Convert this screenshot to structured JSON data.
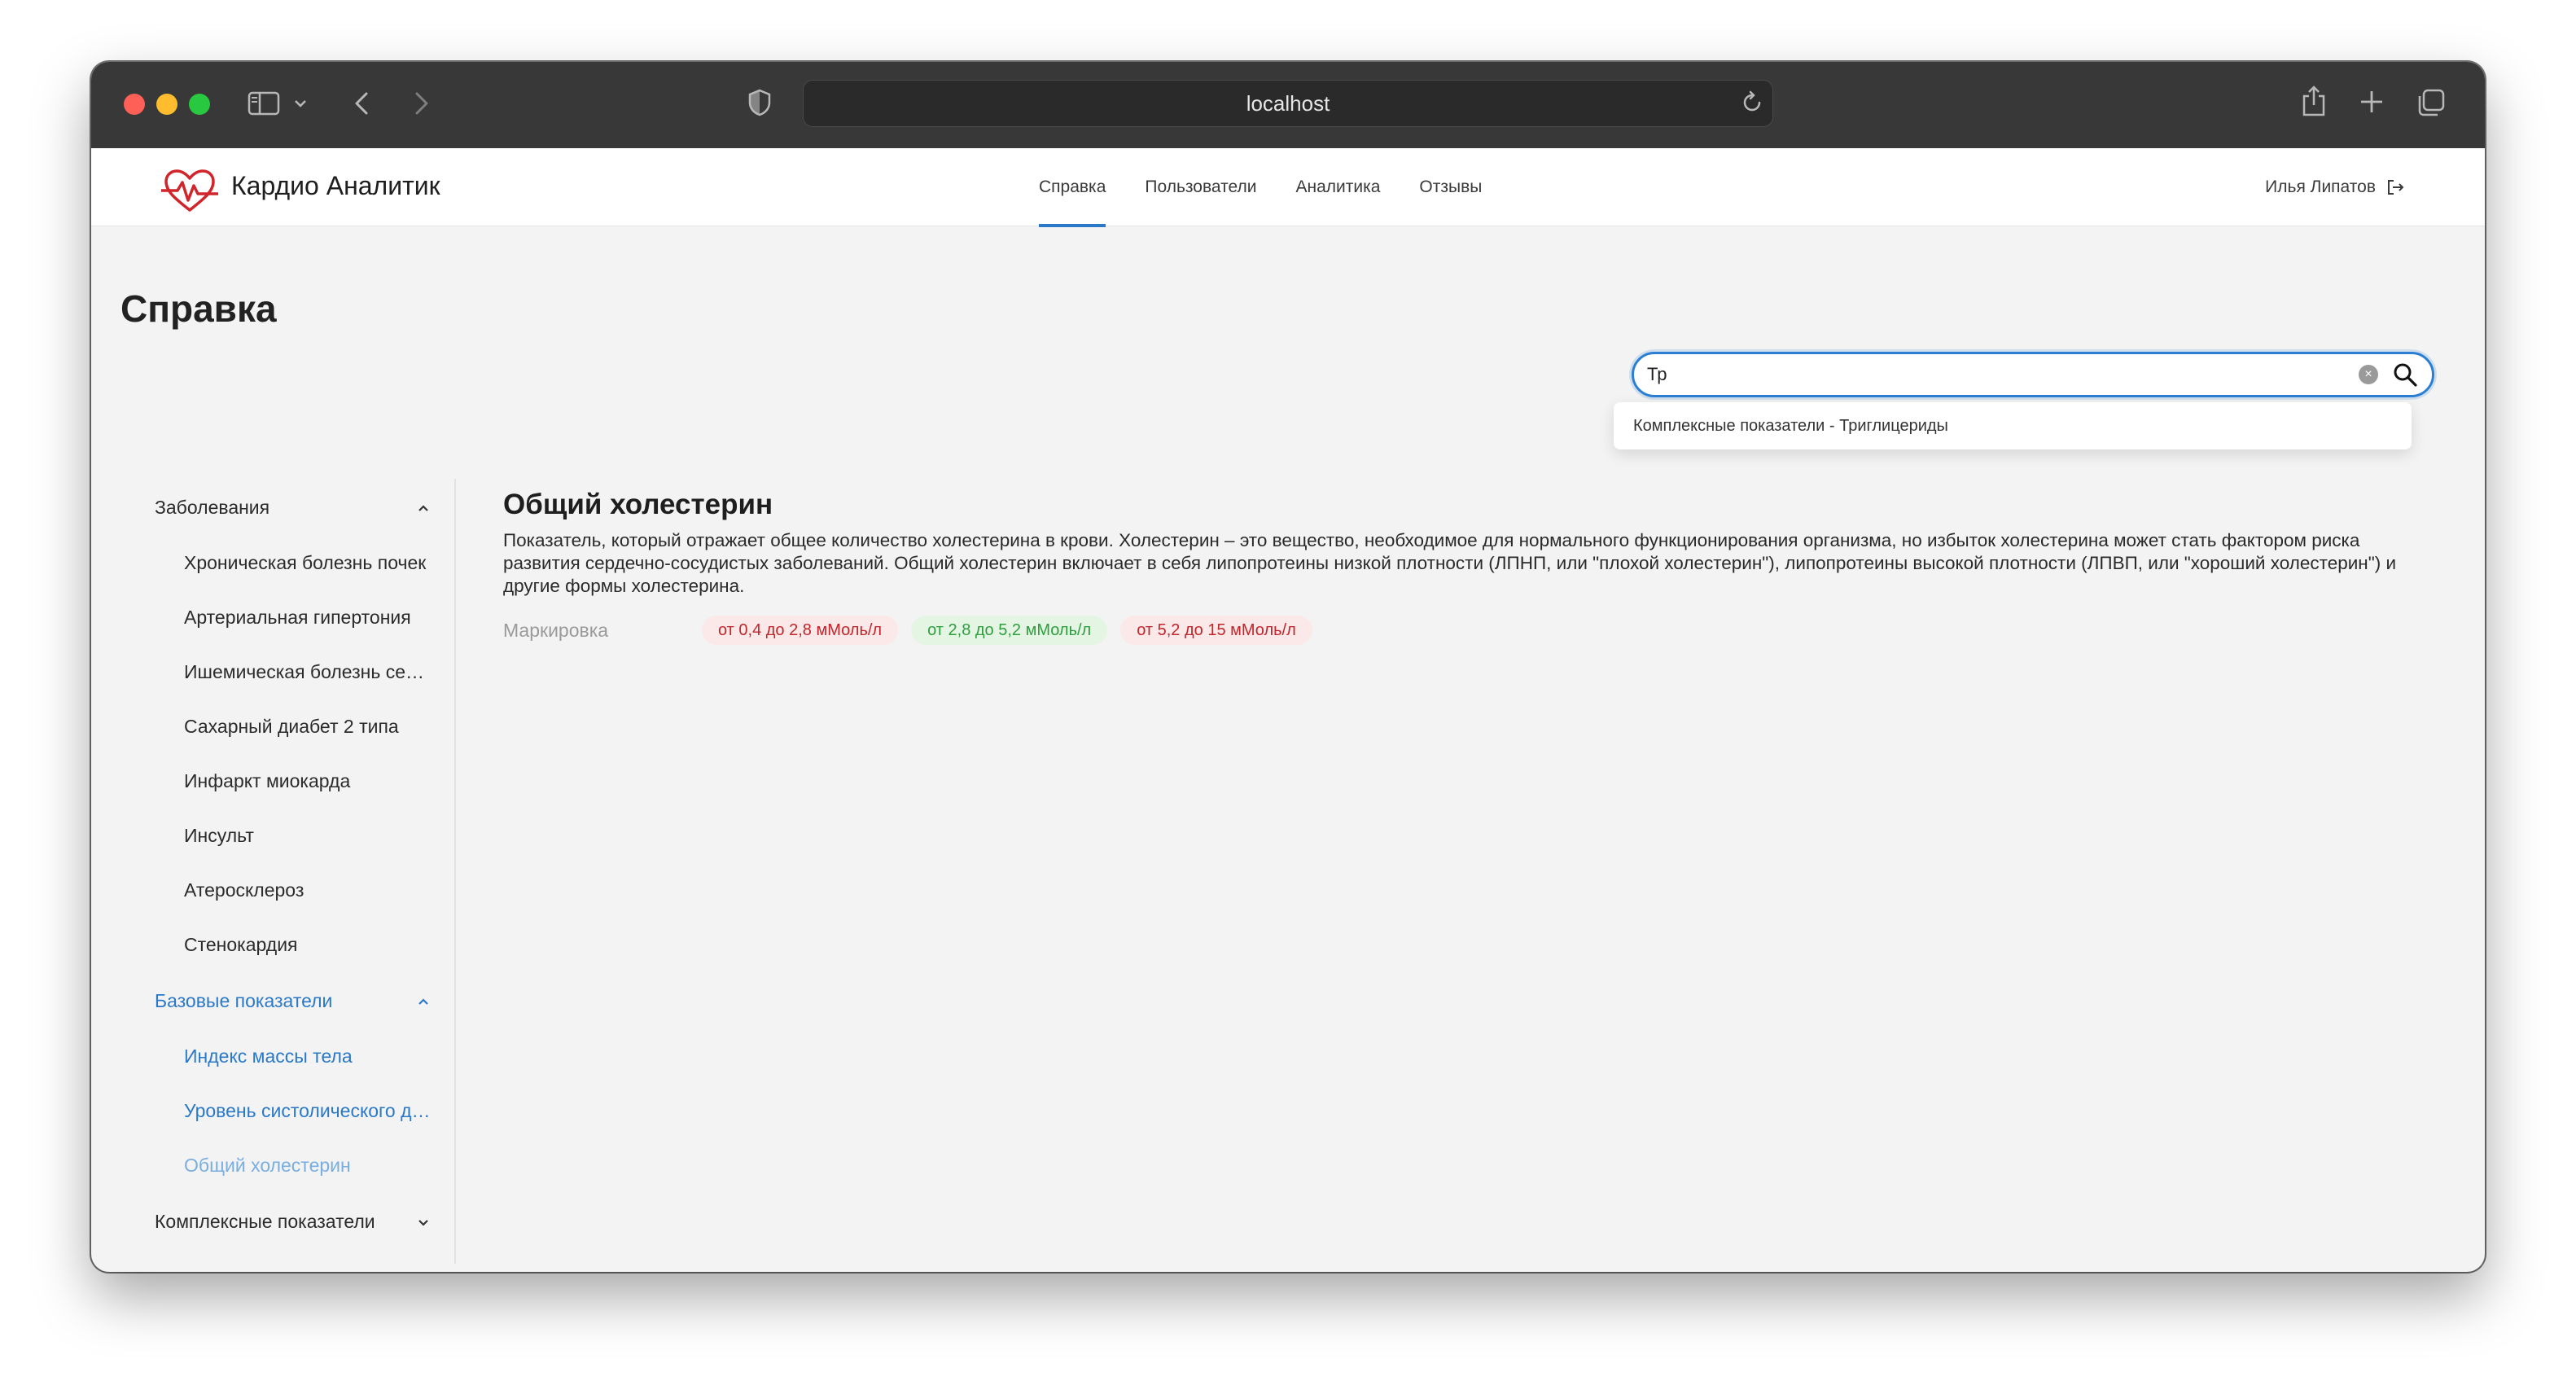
{
  "browser": {
    "url": "localhost"
  },
  "header": {
    "brand": "Кардио Аналитик",
    "nav": [
      {
        "label": "Справка",
        "active": true
      },
      {
        "label": "Пользователи",
        "active": false
      },
      {
        "label": "Аналитика",
        "active": false
      },
      {
        "label": "Отзывы",
        "active": false
      }
    ],
    "user_name": "Илья Липатов"
  },
  "page": {
    "title": "Справка"
  },
  "search": {
    "value": "Тр",
    "suggestion": "Комплексные показатели - Триглицериды"
  },
  "sidebar": {
    "groups": [
      {
        "label": "Заболевания",
        "expanded": true,
        "items": [
          "Хроническая болезнь почек",
          "Артериальная гипертония",
          "Ишемическая болезнь сердца",
          "Сахарный диабет 2 типа",
          "Инфаркт миокарда",
          "Инсульт",
          "Атеросклероз",
          "Стенокардия"
        ]
      },
      {
        "label": "Базовые показатели",
        "expanded": true,
        "items": [
          "Индекс массы тела",
          "Уровень систолического давления",
          "Общий холестерин"
        ]
      },
      {
        "label": "Комплексные показатели",
        "expanded": false,
        "items": []
      }
    ]
  },
  "article": {
    "title": "Общий холестерин",
    "description": "Показатель, который отражает общее количество холестерина в крови. Холестерин – это вещество, необходимое для нормального функционирования организма, но избыток холестерина может стать фактором риска развития сердечно-сосудистых заболеваний. Общий холестерин включает в себя липопротеины низкой плотности (ЛПНП, или \"плохой холестерин\"), липопротеины высокой плотности (ЛПВП, или \"хороший холестерин\") и другие формы холестерина.",
    "marks_label": "Маркировка",
    "marks": [
      {
        "text": "от 0,4 до 2,8 мМоль/л",
        "status": "red"
      },
      {
        "text": "от 2,8 до 5,2 мМоль/л",
        "status": "green"
      },
      {
        "text": "от 5,2 до 15 мМоль/л",
        "status": "red"
      }
    ]
  },
  "colors": {
    "accent": "#2a79c9",
    "danger": "#c0262b",
    "success": "#2f9e3e",
    "logo": "#d0252b"
  }
}
